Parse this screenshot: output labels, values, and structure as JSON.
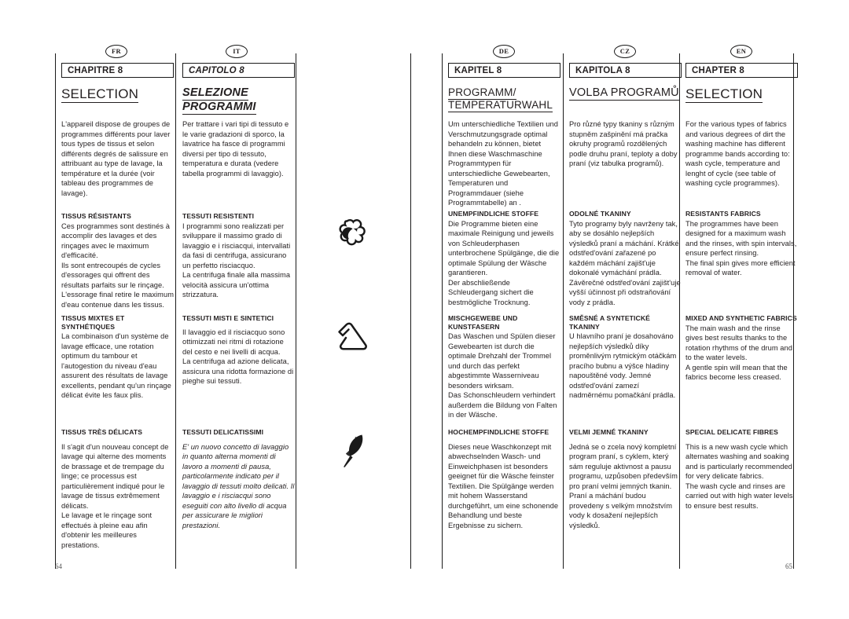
{
  "page": {
    "left_number": "64",
    "right_number": "65"
  },
  "columns": [
    {
      "badge": "FR",
      "chapter": "CHAPITRE 8",
      "title": "SELECTION",
      "intro": "L'appareil dispose de groupes de programmes différents pour laver tous types de tissus et selon différents degrés de salissure en attribuant au type de lavage, la température et la durée (voir tableau des programmes de lavage).",
      "sections": [
        {
          "heading": "TISSUS RÉSISTANTS",
          "body": "Ces programmes sont destinés à accomplir des lavages et des rinçages avec le maximum d'efficacité.\nIls sont entrecoupés de cycles d'essorages qui offrent des résultats parfaits sur le rinçage.\nL'essorage final retire le maximum d'eau contenue dans les tissus."
        },
        {
          "heading": "TISSUS MIXTES ET SYNTHÉTIQUES",
          "body": "La combinaison d'un système de lavage efficace, une rotation optimum du tambour et l'autogestion du niveau d'eau assurent des résultats de lavage excellents, pendant qu'un rinçage délicat évite les faux plis."
        },
        {
          "heading": "TISSUS TRÈS DÉLICATS",
          "body": "Il s'agit d'un nouveau concept de lavage qui alterne des moments de brassage et de trempage du linge; ce processus est particulièrement indiqué pour le lavage de tissus extrêmement délicats.\nLe lavage et le rinçage sont effectués à pleine eau afin d'obtenir les meilleures prestations."
        }
      ]
    },
    {
      "badge": "IT",
      "chapter": "CAPITOLO 8",
      "title": "SELEZIONE PROGRAMMI",
      "intro": "Per trattare i vari tipi di tessuto e le varie gradazioni di sporco, la lavatrice ha fasce di programmi diversi per tipo di tessuto, temperatura e durata (vedere tabella programmi di lavaggio).",
      "sections": [
        {
          "heading": "TESSUTI RESISTENTI",
          "body": "I programmi sono realizzati per sviluppare il massimo grado di lavaggio e i risciacqui, intervallati da fasi di centrifuga, assicurano un perfetto risciacquo.\nLa centrifuga finale alla massima velocità assicura un'ottima strizzatura."
        },
        {
          "heading": "TESSUTI MISTI E SINTETICI",
          "body": "Il lavaggio ed il risciacquo sono ottimizzati nei ritmi di rotazione del cesto e nei livelli di acqua.\nLa centrifuga ad azione delicata, assicura una ridotta formazione di pieghe sui tessuti."
        },
        {
          "heading": "TESSUTI DELICATISSIMI",
          "body": "E' un nuovo concetto di lavaggio in quanto alterna momenti di lavoro a momenti di pausa, particolarmente indicato per il lavaggio di tessuti molto delicati. Il lavaggio e i risciacqui sono eseguiti con alto livello di acqua per assicurare le migliori prestazioni."
        }
      ]
    },
    {
      "badge": "DE",
      "chapter": "KAPITEL 8",
      "title": "PROGRAMM/ TEMPERATURWAHL",
      "intro": "Um unterschiedliche Textilien und Verschmutzungsgrade optimal behandeln zu können, bietet Ihnen diese Waschmaschine Programmtypen für unterschiedliche Gewebearten, Temperaturen und Programmdauer (siehe Programmtabelle) an .",
      "sections": [
        {
          "heading": "UNEMPFINDLICHE STOFFE",
          "body": "Die Programme bieten eine maximale Reinigung und jeweils von Schleuderphasen unterbrochene Spülgänge, die die optimale Spülung der Wäsche garantieren.\nDer abschließende Schleudergang sichert die bestmögliche Trocknung."
        },
        {
          "heading": "MISCHGEWEBE UND KUNSTFASERN",
          "body": "Das Waschen und Spülen dieser Gewebearten ist durch die optimale Drehzahl der Trommel und durch das perfekt abgestimmte Wasserniveau besonders wirksam.\nDas Schonschleudern verhindert außerdem die Bildung von Falten in der Wäsche."
        },
        {
          "heading": "HOCHEMPFINDLICHE STOFFE",
          "body": "Dieses neue Waschkonzept mit abwechselnden Wasch- und Einweichphasen ist besonders geeignet für die Wäsche feinster Textilien. Die Spülgänge werden mit hohem Wasserstand durchgeführt, um eine schonende Behandlung und beste Ergebnisse zu sichern."
        }
      ]
    },
    {
      "badge": "CZ",
      "chapter": "KAPITOLA 8",
      "title": "VOLBA PROGRAMŮ",
      "intro": "Pro různé  typy tkaniny s různým stupněm zašpinění má pračka okruhy programů rozdělených podle druhu praní, teploty a doby praní (viz tabulka programů).",
      "sections": [
        {
          "heading": "ODOLNÉ TKANINY",
          "body": "Tyto programy byly navrženy tak, aby se dosáhlo nejlepších výsledků praní a máchání. Krátké odstřed'ování zařazené po každém máchání zajišt'uje dokonalé vymáchání prádla.\nZávěrečné odstřed'ování zajišt'uje vyšší účinnost při odstraňování vody z prádla."
        },
        {
          "heading": "SMĚSNÉ A SYNTETICKÉ TKANINY",
          "body": "U hlavního praní je dosahováno nejlepších výsledků díky proměnlivým rytmickým otáčkám pracího bubnu a výšce hladiny napouštěné vody. Jemné odstřed'ování zamezí nadměrnému pomačkání prádla."
        },
        {
          "heading": "VELMI JEMNÉ TKANINY",
          "body": "Jedná se o zcela nový kompletní program praní, s cyklem, který sám reguluje aktivnost a pausu programu, uzpůsoben především pro praní velmi jemných tkanin.\nPraní a máchání budou provedeny s velkým množstvím vody k dosažení nejlepších výsledků."
        }
      ]
    },
    {
      "badge": "EN",
      "chapter": "CHAPTER 8",
      "title": "SELECTION",
      "intro": "For the various types of fabrics and various degrees of dirt the washing machine has different programme bands according to: wash cycle, temperature and lenght of cycle (see table of washing cycle programmes).",
      "sections": [
        {
          "heading": "RESISTANTS FABRICS",
          "body": "The programmes have been designed for a maximum wash and the rinses, with spin intervals, ensure perfect rinsing.\nThe final spin gives more efficient removal of water."
        },
        {
          "heading": "MIXED AND SYNTHETIC FABRICS",
          "body": "The main wash and the rinse gives best results thanks to the rotation rhythms of the drum and to the water levels.\nA gentle spin will mean that the fabrics become less creased."
        },
        {
          "heading": "SPECIAL DELICATE FIBRES",
          "body": "This is a new wash cycle which alternates washing and soaking and is particularly recommended for very delicate fabrics.\nThe wash cycle and rinses are carried out with high water levels to ensure best results."
        }
      ]
    }
  ],
  "icons": [
    {
      "name": "cotton-boll-icon"
    },
    {
      "name": "synthetics-triangle-icon"
    },
    {
      "name": "feather-icon"
    }
  ]
}
